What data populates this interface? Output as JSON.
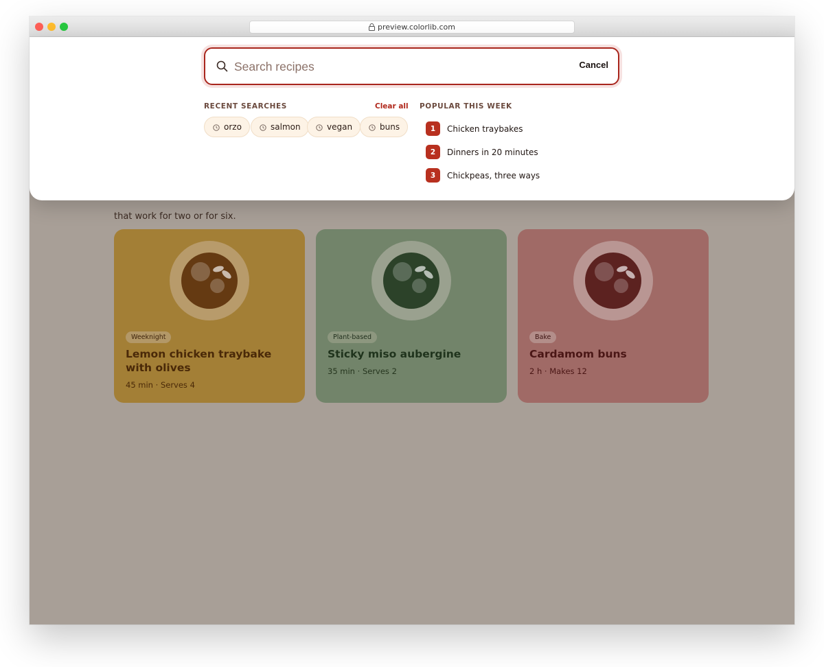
{
  "browser": {
    "url": "preview.colorlib.com"
  },
  "page": {
    "subtitle_partial": "that work for two or for six.",
    "cards": [
      {
        "tag": "Weeknight",
        "title": "Lemon chicken traybake with olives",
        "meta": "45 min · Serves 4",
        "color": "#a37f36"
      },
      {
        "tag": "Plant-based",
        "title": "Sticky miso aubergine",
        "meta": "35 min · Serves 2",
        "color": "#72846a"
      },
      {
        "tag": "Bake",
        "title": "Cardamom buns",
        "meta": "2 h · Makes 12",
        "color": "#a06a66"
      }
    ]
  },
  "search": {
    "placeholder": "Search recipes",
    "value": "",
    "cancel_label": "Cancel",
    "recent_label": "RECENT SEARCHES",
    "clear_label": "Clear all",
    "recent": [
      "orzo",
      "salmon",
      "vegan",
      "buns"
    ],
    "popular_label": "POPULAR THIS WEEK",
    "popular": [
      {
        "rank": "1",
        "label": "Chicken traybakes"
      },
      {
        "rank": "2",
        "label": "Dinners in 20 minutes"
      },
      {
        "rank": "3",
        "label": "Chickpeas, three ways"
      }
    ],
    "accent_color": "#b0281c"
  }
}
